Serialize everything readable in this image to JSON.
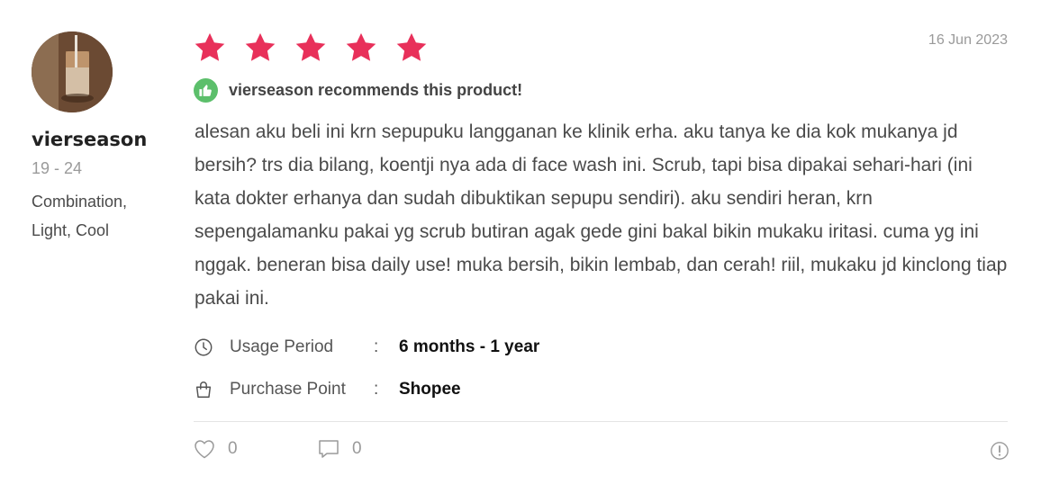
{
  "reviewer": {
    "username": "vierseason",
    "age_range": "19 - 24",
    "skin_profile": "Combination, Light, Cool",
    "avatar_icon": "avatar-photo"
  },
  "rating": {
    "stars": 5,
    "max": 5,
    "star_color": "#e8305a"
  },
  "date": "16 Jun 2023",
  "recommendation": {
    "text": "vierseason recommends this product!",
    "icon": "thumbs-up-icon",
    "color": "#5cbf6b"
  },
  "review_text": "alesan aku beli ini krn sepupuku langganan ke klinik erha. aku tanya ke dia kok mukanya jd bersih? trs dia bilang, koentji nya ada di face wash ini. Scrub, tapi bisa dipakai sehari-hari (ini kata dokter erhanya dan sudah dibuktikan sepupu sendiri). aku sendiri heran, krn sepengalamanku pakai yg scrub butiran agak gede gini bakal bikin mukaku iritasi. cuma yg ini nggak. beneran bisa daily use! muka bersih, bikin lembab, dan cerah! riil, mukaku jd kinclong tiap pakai ini.",
  "details": {
    "usage_period": {
      "label": "Usage Period",
      "separator": ":",
      "value": "6 months - 1 year",
      "icon": "clock-icon"
    },
    "purchase_point": {
      "label": "Purchase Point",
      "separator": ":",
      "value": "Shopee",
      "icon": "shopping-bag-icon"
    }
  },
  "actions": {
    "likes": "0",
    "comments": "0",
    "like_icon": "heart-icon",
    "comment_icon": "comment-icon",
    "report_icon": "report-icon"
  }
}
